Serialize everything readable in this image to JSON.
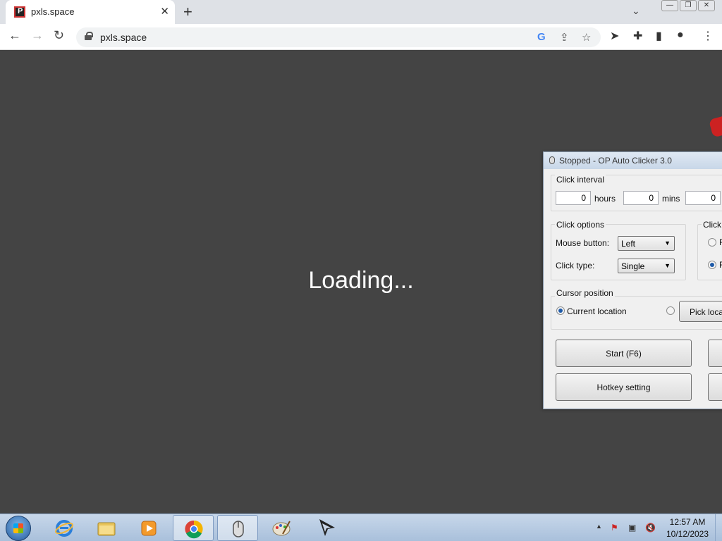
{
  "browser": {
    "tab_title": "pxls.space",
    "tab_close": "✕",
    "new_tab": "+",
    "url": "pxls.space",
    "nav": {
      "back": "←",
      "forward": "→",
      "reload": "↻"
    }
  },
  "page": {
    "loading_text": "Loading..."
  },
  "autoclicker": {
    "title": "Stopped - OP Auto Clicker 3.0",
    "click_interval": {
      "label": "Click interval",
      "hours_value": "0",
      "hours_label": "hours",
      "mins_value": "0",
      "mins_label": "mins",
      "secs_value": "0"
    },
    "click_options": {
      "label": "Click options",
      "mouse_button_label": "Mouse button:",
      "mouse_button_value": "Left",
      "click_type_label": "Click type:",
      "click_type_value": "Single"
    },
    "click_repeat": {
      "label": "Click r",
      "opt1": "R",
      "opt2": "R"
    },
    "cursor_position": {
      "label": "Cursor position",
      "current_location": "Current location",
      "pick_location": "Pick locat"
    },
    "buttons": {
      "start": "Start (F6)",
      "hotkey": "Hotkey setting"
    }
  },
  "taskbar": {
    "time": "12:57 AM",
    "date": "10/12/2023",
    "tray_arrow": "▲"
  }
}
